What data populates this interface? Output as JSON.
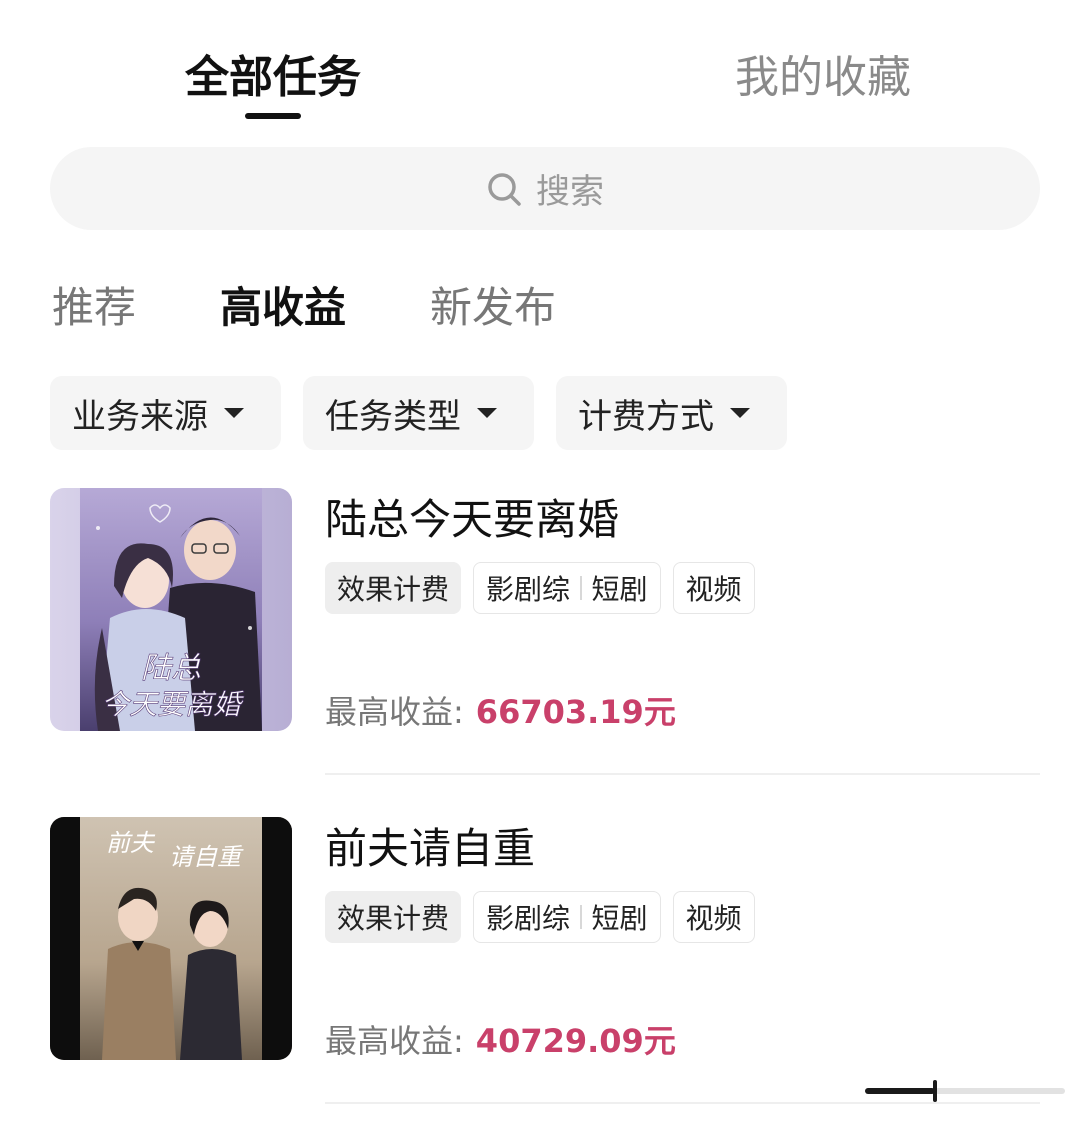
{
  "top_tabs": {
    "active": "全部任务",
    "inactive": "我的收藏"
  },
  "search": {
    "placeholder": "搜索",
    "icon": "search-icon"
  },
  "category_tabs": [
    "推荐",
    "高收益",
    "新发布"
  ],
  "selected_category": "高收益",
  "filters": [
    "业务来源",
    "任务类型",
    "计费方式"
  ],
  "tasks": [
    {
      "title": "陆总今天要离婚",
      "poster_text": [
        "陆总",
        "今天要离婚"
      ],
      "tags": {
        "billing": "效果计费",
        "category": "影剧综",
        "subcategory": "短剧",
        "format": "视频"
      },
      "earning_label": "最高收益:",
      "earning_value": "66703.19元"
    },
    {
      "title": "前夫请自重",
      "poster_text": [
        "前夫",
        "请自重"
      ],
      "tags": {
        "billing": "效果计费",
        "category": "影剧综",
        "subcategory": "短剧",
        "format": "视频"
      },
      "earning_label": "最高收益:",
      "earning_value": "40729.09元"
    }
  ],
  "colors": {
    "accent_earning": "#c9406a",
    "chip_bg": "#f5f5f5",
    "text_primary": "#111111",
    "text_muted": "#777777"
  }
}
